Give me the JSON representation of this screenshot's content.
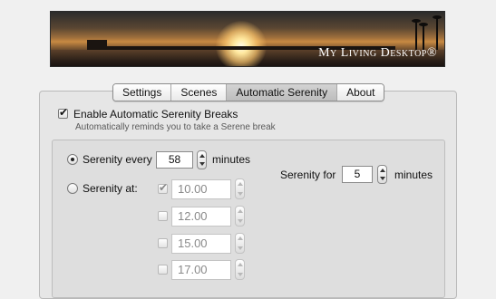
{
  "banner": {
    "brand": "My Living Desktop®"
  },
  "tabs": [
    {
      "label": "Settings",
      "selected": false
    },
    {
      "label": "Scenes",
      "selected": false
    },
    {
      "label": "Automatic Serenity",
      "selected": true
    },
    {
      "label": "About",
      "selected": false
    }
  ],
  "enable": {
    "label": "Enable Automatic Serenity Breaks",
    "checked": true,
    "description": "Automatically reminds you to take a Serene break"
  },
  "every": {
    "label": "Serenity every",
    "value": "58",
    "unit": "minutes",
    "selected": true
  },
  "at": {
    "label": "Serenity at:",
    "selected": false,
    "times": [
      {
        "value": "10.00",
        "checked": true
      },
      {
        "value": "12.00",
        "checked": false
      },
      {
        "value": "15.00",
        "checked": false
      },
      {
        "value": "17.00",
        "checked": false
      }
    ]
  },
  "duration": {
    "label": "Serenity for",
    "value": "5",
    "unit": "minutes"
  }
}
